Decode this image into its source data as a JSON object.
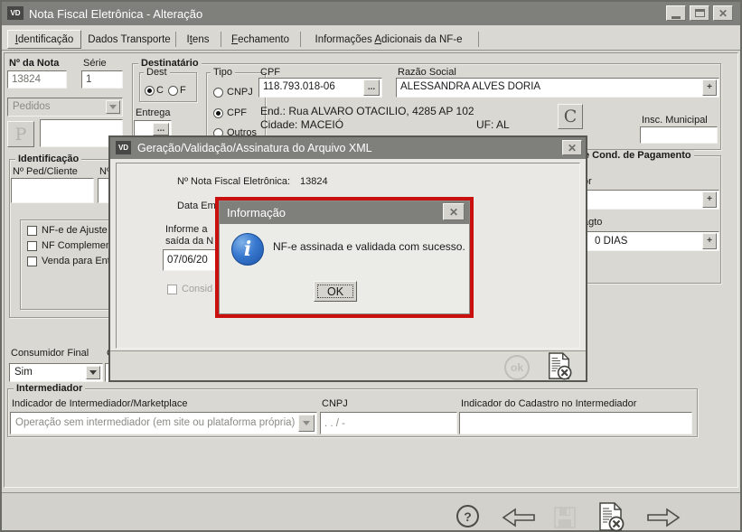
{
  "icons": {
    "close": "✕",
    "ellipsis": "...",
    "plus": "+",
    "help": "?"
  },
  "window": {
    "badge": "VD",
    "title": "Nota Fiscal Eletrônica - Alteração"
  },
  "tabs": [
    {
      "label": "Identificação"
    },
    {
      "label": "Dados Transporte"
    },
    {
      "label": "Itens"
    },
    {
      "label": "Fechamento"
    },
    {
      "label": "Informações Adicionais da NF-e"
    }
  ],
  "nota": {
    "numero_label": "Nº da Nota",
    "numero": "13824",
    "serie_label": "Série",
    "serie": "1",
    "origem": "Pedidos",
    "p_button": "P"
  },
  "destinatario": {
    "title": "Destinatário",
    "dest_label": "Dest",
    "dest_c": "C",
    "dest_f": "F",
    "tipo_label": "Tipo",
    "tipo_cnpj": "CNPJ",
    "tipo_cpf": "CPF",
    "tipo_outros": "Outros",
    "entrega_label": "Entrega",
    "cpf_label": "CPF",
    "cpf": "118.793.018-06",
    "razao_label": "Razão Social",
    "razao": "ALESSANDRA ALVES DORIA",
    "endereco": "End.: Rua ALVARO OTACILIO, 4285 AP 102",
    "cidade": "Cidade: MACEIÓ",
    "uf": "UF: AL",
    "c_button": "C",
    "insc_municipal_label": "Insc. Municipal"
  },
  "identificacao": {
    "title": "Identificação",
    "ped_cliente_label": "Nº Ped/Cliente",
    "ped2_label": "Nº",
    "chk_ajuste": "NF-e de Ajuste",
    "chk_complementar": "NF Complementar",
    "chk_venda": "Venda para Entre"
  },
  "pagamento": {
    "title_fragment": "e Cond. de Pagamento",
    "vendedor_fragment": "or",
    "pagto_fragment": "agto",
    "pagto_value_fragment": "0 DIAS"
  },
  "consumidor": {
    "label": "Consumidor Final",
    "value": "Sim",
    "label2_fragment": "C",
    "value2_fragment": "N"
  },
  "intermediador": {
    "title": "Intermediador",
    "indicador_label": "Indicador de Intermediador/Marketplace",
    "indicador_value": "Operação sem intermediador (em site ou plataforma própria)",
    "cnpj_label": "CNPJ",
    "cnpj_mask": ".   .   /    -",
    "cadastro_label": "Indicador do Cadastro no Intermediador"
  },
  "xml_dialog": {
    "title": "Geração/Validação/Assinatura do Arquivo XML",
    "nfe_label": "Nº Nota Fiscal Eletrônica:",
    "nfe_numero": "13824",
    "data_fragment": "Data Emis",
    "informe_line1": "Informe a",
    "informe_line2": "saída da N",
    "data_value": "07/06/20",
    "consider_fragment": "Consid",
    "ok_label": "ok"
  },
  "msgbox": {
    "title": "Informação",
    "message": "NF-e assinada e validada com sucesso.",
    "ok_label": "OK"
  }
}
